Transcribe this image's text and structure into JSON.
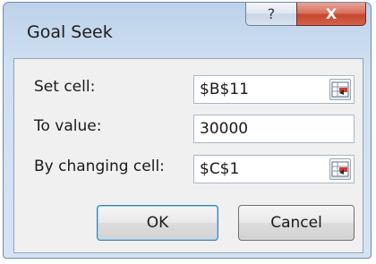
{
  "window": {
    "title": "Goal Seek"
  },
  "titlebar": {
    "help_icon_text": "?",
    "close_icon_text": "X",
    "colors": {
      "close_red": "#c7462f"
    }
  },
  "form": {
    "set_cell": {
      "label": "Set cell:",
      "value": "$B$11"
    },
    "to_value": {
      "label": "To value:",
      "value": "30000"
    },
    "by_changing_cell": {
      "label": "By changing cell:",
      "value": "$C$1"
    }
  },
  "buttons": {
    "ok": "OK",
    "cancel": "Cancel"
  },
  "icons": {
    "picker": "range-selector-icon"
  }
}
